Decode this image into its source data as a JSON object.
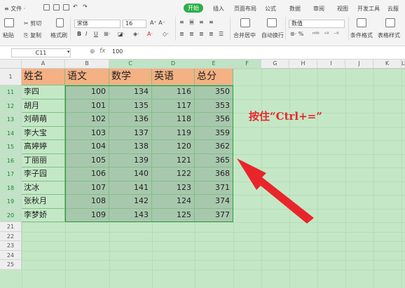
{
  "menu": {
    "file": "≡ 文件 ·",
    "tabs": [
      {
        "label": "开始",
        "active": true
      },
      {
        "label": "插入"
      },
      {
        "label": "页面布局"
      },
      {
        "label": "公式"
      },
      {
        "label": "数据"
      },
      {
        "label": "审阅"
      },
      {
        "label": "视图"
      },
      {
        "label": "开发工具"
      },
      {
        "label": "云服"
      }
    ]
  },
  "ribbon": {
    "paste": "粘贴",
    "cut": "剪切",
    "copy": "复制",
    "format_painter": "格式刷",
    "font_name": "宋体",
    "font_size": "16",
    "merge": "合并居中",
    "wrap": "自动换行",
    "number_format": "数值",
    "conditional": "条件格式",
    "table_style": "表格样式"
  },
  "formula_bar": {
    "cell_ref": "C11",
    "value": "100"
  },
  "sheet": {
    "columns": [
      "A",
      "B",
      "C",
      "D",
      "E",
      "F",
      "G",
      "H",
      "I",
      "J",
      "K",
      "L"
    ],
    "header_row": {
      "row": "1",
      "cells": [
        "姓名",
        "语文",
        "数学",
        "英语",
        "总分"
      ]
    },
    "rows": [
      {
        "row": "11",
        "name": "李四",
        "chinese": "100",
        "math": "134",
        "english": "116",
        "total": "350"
      },
      {
        "row": "12",
        "name": "胡月",
        "chinese": "101",
        "math": "135",
        "english": "117",
        "total": "353"
      },
      {
        "row": "13",
        "name": "刘萌萌",
        "chinese": "102",
        "math": "136",
        "english": "118",
        "total": "356"
      },
      {
        "row": "14",
        "name": "李大宝",
        "chinese": "103",
        "math": "137",
        "english": "119",
        "total": "359"
      },
      {
        "row": "15",
        "name": "高婷婷",
        "chinese": "104",
        "math": "138",
        "english": "120",
        "total": "362"
      },
      {
        "row": "16",
        "name": "丁丽丽",
        "chinese": "105",
        "math": "139",
        "english": "121",
        "total": "365"
      },
      {
        "row": "17",
        "name": "李子园",
        "chinese": "106",
        "math": "140",
        "english": "122",
        "total": "368"
      },
      {
        "row": "18",
        "name": "沈冰",
        "chinese": "107",
        "math": "141",
        "english": "123",
        "total": "371"
      },
      {
        "row": "19",
        "name": "张秋月",
        "chinese": "108",
        "math": "142",
        "english": "124",
        "total": "374"
      },
      {
        "row": "20",
        "name": "李梦娇",
        "chinese": "109",
        "math": "143",
        "english": "125",
        "total": "377"
      }
    ],
    "empty_rows": [
      "21",
      "22",
      "23",
      "24",
      "25"
    ]
  },
  "annotation": "按住“Ctrl+=”",
  "colors": {
    "accent": "#2dae4b",
    "header_fill": "#f4b183",
    "sheet_bg": "#c4e8c6",
    "selection_fill": "#a8c8ad",
    "annotation": "#e8252b"
  }
}
